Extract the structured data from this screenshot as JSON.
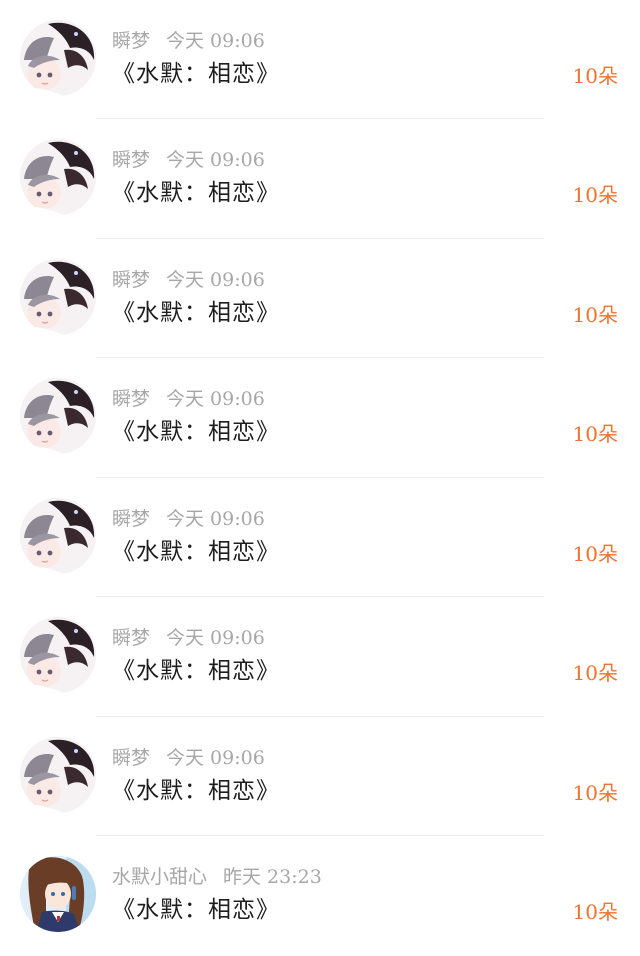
{
  "colors": {
    "accent": "#f0732c"
  },
  "messages": [
    {
      "avatar": "avatar-anime-dark-hair-icon",
      "name": "瞬梦",
      "time": "今天 09:06",
      "title": "《水默：相恋》",
      "count": "10朵"
    },
    {
      "avatar": "avatar-anime-dark-hair-icon",
      "name": "瞬梦",
      "time": "今天 09:06",
      "title": "《水默：相恋》",
      "count": "10朵"
    },
    {
      "avatar": "avatar-anime-dark-hair-icon",
      "name": "瞬梦",
      "time": "今天 09:06",
      "title": "《水默：相恋》",
      "count": "10朵"
    },
    {
      "avatar": "avatar-anime-dark-hair-icon",
      "name": "瞬梦",
      "time": "今天 09:06",
      "title": "《水默：相恋》",
      "count": "10朵"
    },
    {
      "avatar": "avatar-anime-dark-hair-icon",
      "name": "瞬梦",
      "time": "今天 09:06",
      "title": "《水默：相恋》",
      "count": "10朵"
    },
    {
      "avatar": "avatar-anime-dark-hair-icon",
      "name": "瞬梦",
      "time": "今天 09:06",
      "title": "《水默：相恋》",
      "count": "10朵"
    },
    {
      "avatar": "avatar-anime-dark-hair-icon",
      "name": "瞬梦",
      "time": "今天 09:06",
      "title": "《水默：相恋》",
      "count": "10朵"
    },
    {
      "avatar": "avatar-anime-brown-hair-icon",
      "name": "水默小甜心",
      "time": "昨天 23:23",
      "title": "《水默：相恋》",
      "count": "10朵"
    }
  ]
}
